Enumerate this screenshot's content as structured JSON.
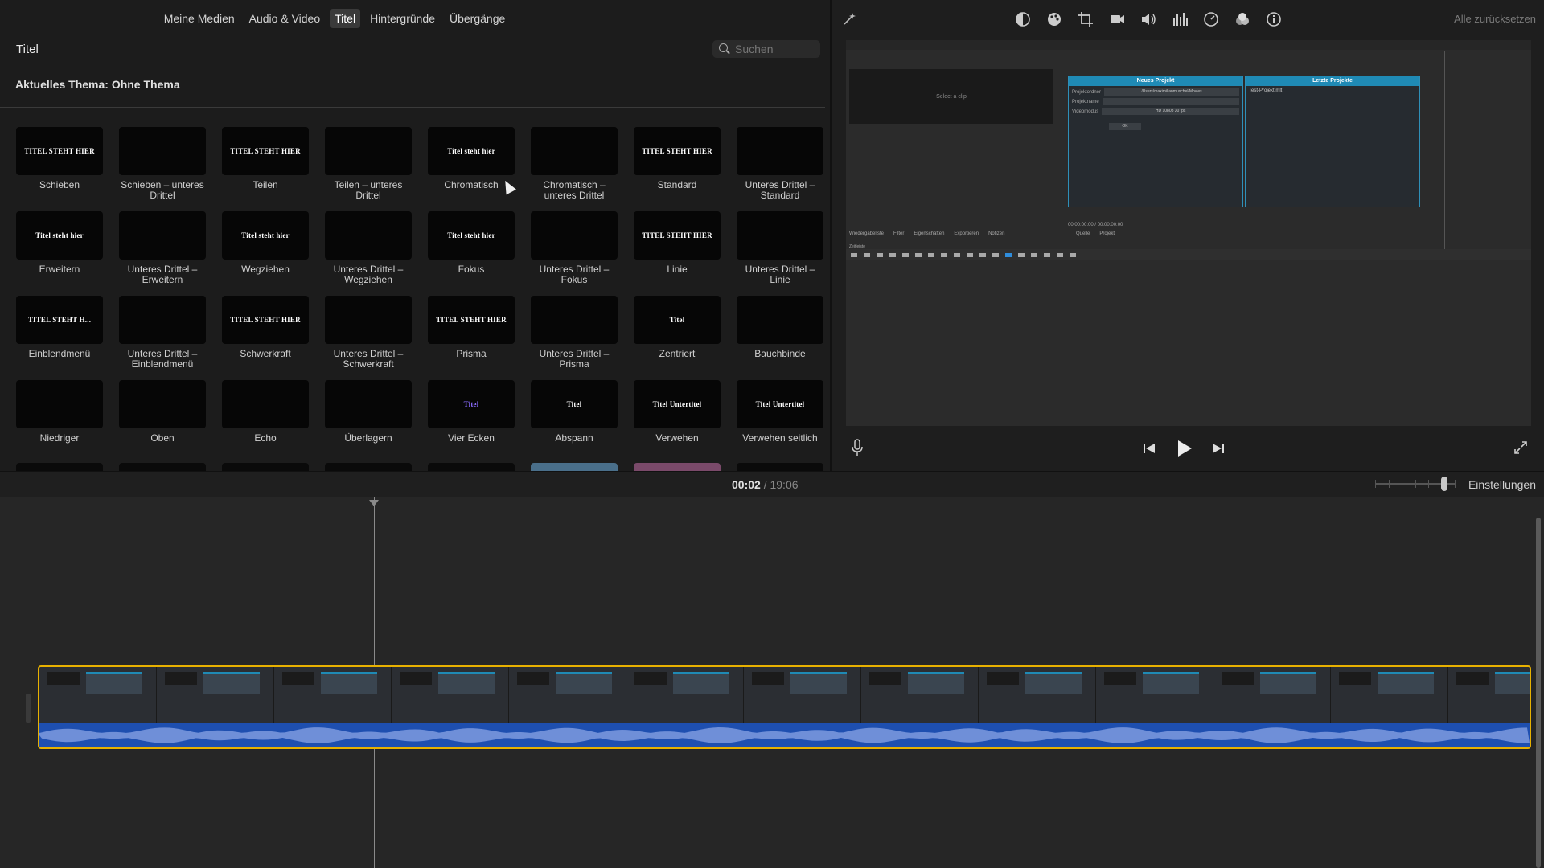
{
  "categories": [
    "Meine Medien",
    "Audio & Video",
    "Titel",
    "Hintergründe",
    "Übergänge"
  ],
  "active_category": "Titel",
  "browser": {
    "title": "Titel",
    "search_placeholder": "Suchen",
    "theme_label": "Aktuelles Thema: Ohne Thema"
  },
  "tiles": [
    {
      "label": "Schieben",
      "thumb": "TITEL STEHT HIER"
    },
    {
      "label": "Schieben – unteres Drittel",
      "thumb": ""
    },
    {
      "label": "Teilen",
      "thumb": "TITEL STEHT HIER"
    },
    {
      "label": "Teilen – unteres Drittel",
      "thumb": ""
    },
    {
      "label": "Chromatisch",
      "thumb": "Titel steht hier"
    },
    {
      "label": "Chromatisch – unteres Drittel",
      "thumb": ""
    },
    {
      "label": "Standard",
      "thumb": "TITEL STEHT HIER"
    },
    {
      "label": "Unteres Drittel – Standard",
      "thumb": ""
    },
    {
      "label": "Erweitern",
      "thumb": "Titel steht hier"
    },
    {
      "label": "Unteres Drittel – Erweitern",
      "thumb": ""
    },
    {
      "label": "Wegziehen",
      "thumb": "Titel steht hier"
    },
    {
      "label": "Unteres Drittel – Wegziehen",
      "thumb": ""
    },
    {
      "label": "Fokus",
      "thumb": "Titel steht hier"
    },
    {
      "label": "Unteres Drittel – Fokus",
      "thumb": ""
    },
    {
      "label": "Linie",
      "thumb": "TITEL STEHT HIER"
    },
    {
      "label": "Unteres Drittel – Linie",
      "thumb": ""
    },
    {
      "label": "Einblendmenü",
      "thumb": "TITEL STEHT H..."
    },
    {
      "label": "Unteres Drittel – Einblendmenü",
      "thumb": ""
    },
    {
      "label": "Schwerkraft",
      "thumb": "TITEL STEHT HIER"
    },
    {
      "label": "Unteres Drittel – Schwerkraft",
      "thumb": ""
    },
    {
      "label": "Prisma",
      "thumb": "TITEL STEHT HIER"
    },
    {
      "label": "Unteres Drittel – Prisma",
      "thumb": ""
    },
    {
      "label": "Zentriert",
      "thumb": "Titel"
    },
    {
      "label": "Bauchbinde",
      "thumb": ""
    },
    {
      "label": "Niedriger",
      "thumb": ""
    },
    {
      "label": "Oben",
      "thumb": ""
    },
    {
      "label": "Echo",
      "thumb": ""
    },
    {
      "label": "Überlagern",
      "thumb": ""
    },
    {
      "label": "Vier Ecken",
      "thumb": "Titel"
    },
    {
      "label": "Abspann",
      "thumb": "Titel"
    },
    {
      "label": "Verwehen",
      "thumb": "Titel Untertitel"
    },
    {
      "label": "Verwehen seitlich",
      "thumb": "Titel Untertitel"
    }
  ],
  "viewer": {
    "reset_all": "Alle zurücksetzen",
    "preview": {
      "select_clip": "Select a clip",
      "new_project": "Neues Projekt",
      "recent_projects": "Letzte Projekte",
      "recent_item": "Test-Projekt.mlt",
      "folder_label": "Projektordner",
      "folder_value": "/Users/maximilianmuschel/Movies",
      "name_label": "Projektname",
      "mode_label": "Videomodus",
      "mode_value": "HD 1080p 30 fps",
      "ok_button": "OK",
      "transport_time": "00:00:00:00 / 00:00:00:00",
      "tabs_left": [
        "Wiedergabeliste",
        "Filter",
        "Eigenschaften",
        "Exportieren",
        "Notizen"
      ],
      "tabs_right": [
        "Quelle",
        "Projekt"
      ],
      "timeline_label": "Zeitleiste"
    }
  },
  "timeline": {
    "current": "00:02",
    "separator": "/",
    "total": "19:06",
    "settings": "Einstellungen"
  },
  "colors": {
    "clip_border": "#e8b100",
    "audio": "#1e4fb0",
    "dialog_accent": "#1f8ab5"
  }
}
